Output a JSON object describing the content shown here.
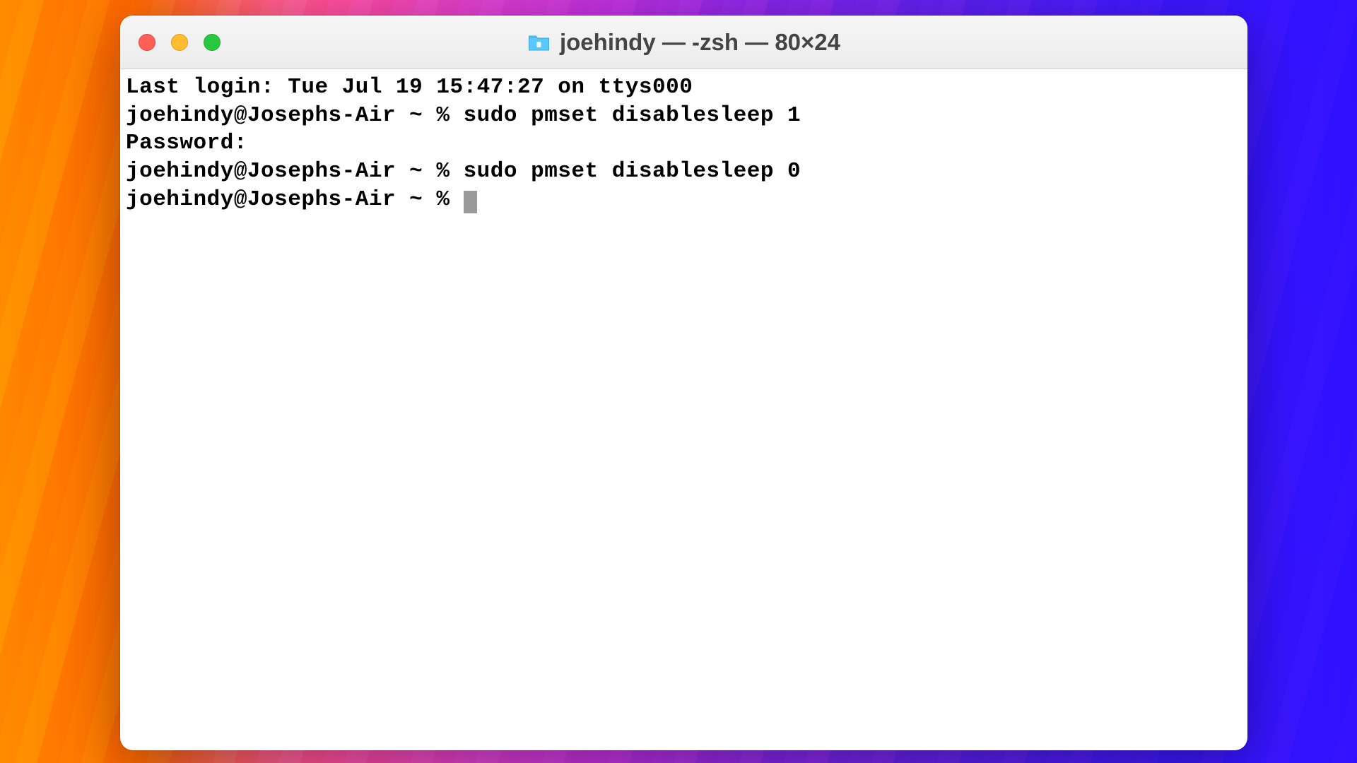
{
  "window": {
    "title": "joehindy — -zsh — 80×24"
  },
  "terminal": {
    "lines": [
      "Last login: Tue Jul 19 15:47:27 on ttys000",
      "joehindy@Josephs-Air ~ % sudo pmset disablesleep 1",
      "Password:",
      "joehindy@Josephs-Air ~ % sudo pmset disablesleep 0",
      "joehindy@Josephs-Air ~ % "
    ]
  },
  "colors": {
    "close": "#ff5f57",
    "minimize": "#febc2e",
    "maximize": "#28c840"
  }
}
